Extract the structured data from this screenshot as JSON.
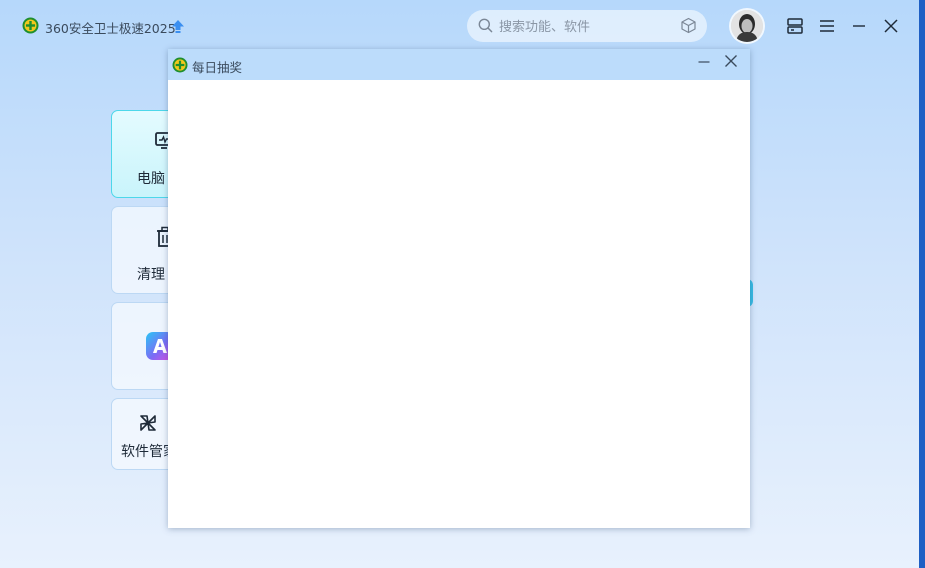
{
  "app": {
    "title": "360安全卫士极速2025",
    "icons": {
      "logo": "360-logo-icon",
      "upgrade": "upgrade-arrow-icon"
    }
  },
  "search": {
    "placeholder": "搜索功能、软件",
    "icon": "search-icon",
    "trailing_icon": "cube-icon"
  },
  "titlebar_buttons": [
    {
      "name": "skin-icon"
    },
    {
      "name": "menu-icon"
    },
    {
      "name": "minimize-icon"
    },
    {
      "name": "close-icon"
    }
  ],
  "cards": [
    {
      "label": "电脑",
      "icon": "monitor-icon",
      "active": true
    },
    {
      "label": "清理",
      "icon": "trash-icon",
      "active": false
    },
    {
      "label": "",
      "icon": "ai-icon",
      "active": false
    },
    {
      "label": "软件管家",
      "icon": "software-manager-icon",
      "active": false
    }
  ],
  "dialog": {
    "title": "每日抽奖",
    "icons": {
      "logo": "360-logo-icon",
      "minimize": "minimize-icon",
      "close": "close-icon"
    }
  },
  "colors": {
    "accent": "#38bde6",
    "active_card_border": "#4dd7ea",
    "dialog_header": "#bcdcfb",
    "window_edge": "#1e5fc4"
  }
}
